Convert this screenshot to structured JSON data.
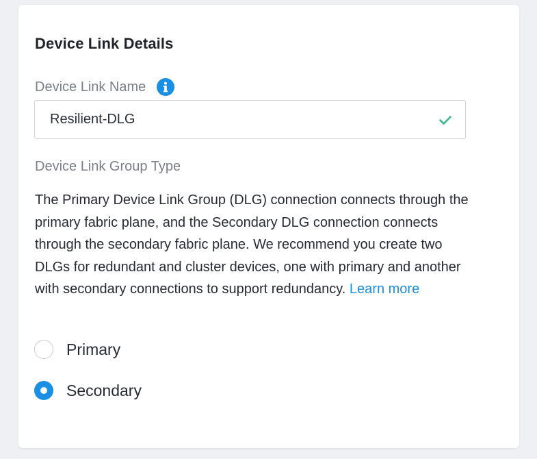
{
  "section": {
    "title": "Device Link Details"
  },
  "name_field": {
    "label": "Device Link Name",
    "value": "Resilient-DLG",
    "info_icon": "info-icon",
    "valid_icon": "check-icon"
  },
  "group_type": {
    "label": "Device Link Group Type",
    "description": "The Primary Device Link Group (DLG) connection connects through the primary fabric plane, and the Secondary DLG connection connects through the secondary fabric plane. We recommend you create two DLGs for redundant and cluster devices, one with primary and another with secondary connections to support redundancy.",
    "learn_more": "Learn more",
    "options": [
      {
        "label": "Primary",
        "selected": false
      },
      {
        "label": "Secondary",
        "selected": true
      }
    ]
  },
  "colors": {
    "accent": "#1a8fe3",
    "valid": "#3bb58a",
    "background": "#eef0f3"
  }
}
